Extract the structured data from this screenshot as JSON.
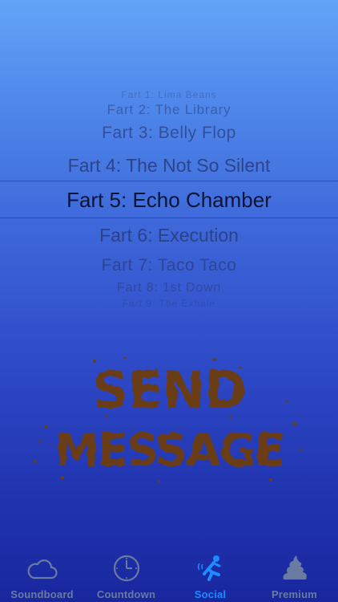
{
  "picker": {
    "selected_index": 4,
    "items": [
      "Fart 1: Lima Beans",
      "Fart 2: The Library",
      "Fart 3: Belly Flop",
      "Fart 4: The Not So Silent",
      "Fart 5: Echo Chamber",
      "Fart 6: Execution",
      "Fart 7: Taco Taco",
      "Fart 8: 1st Down",
      "Fart 9: The Exhale"
    ]
  },
  "send_button": {
    "line1": "SEND",
    "line2": "MESSAGE",
    "color": "#6b3d14"
  },
  "tabbar": {
    "active_color": "#1e8bff",
    "inactive_color": "#6b7aa0",
    "tabs": [
      {
        "label": "Soundboard",
        "icon": "cloud-icon",
        "active": false
      },
      {
        "label": "Countdown",
        "icon": "clock-icon",
        "active": false
      },
      {
        "label": "Social",
        "icon": "running-person-icon",
        "active": true
      },
      {
        "label": "Premium",
        "icon": "poop-icon",
        "active": false
      }
    ]
  }
}
